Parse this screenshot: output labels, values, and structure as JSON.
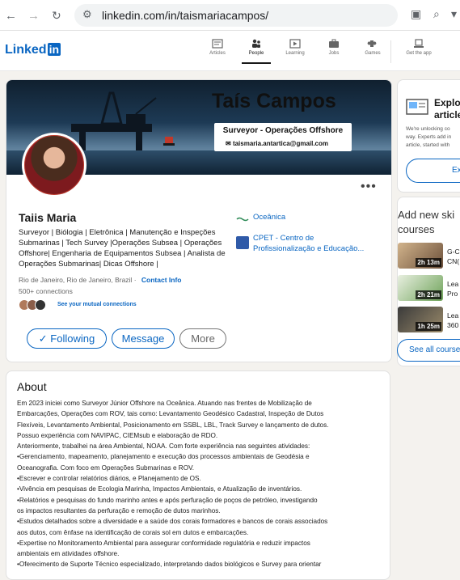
{
  "browser": {
    "url": "linkedin.com/in/taismariacampos/"
  },
  "header": {
    "logo_text": "Linked",
    "logo_in": "in",
    "nav": [
      {
        "label": "Articles",
        "icon": "articles-icon"
      },
      {
        "label": "People",
        "icon": "people-icon",
        "active": true
      },
      {
        "label": "Learning",
        "icon": "learning-icon"
      },
      {
        "label": "Jobs",
        "icon": "jobs-icon"
      },
      {
        "label": "Games",
        "icon": "games-icon"
      },
      {
        "label": "Get the app",
        "icon": "get-app-icon"
      }
    ]
  },
  "profile": {
    "banner_name": "Taís Campos",
    "banner_subtitle": "Surveyor - Operações Offshore",
    "banner_email": "taismaria.antartica@gmail.com",
    "name": "Taiis Maria",
    "headline": "Surveyor | Biólogia | Eletrônica | Manutenção e Inspeções Submarinas | Tech Survey |Operações Subsea | Operações Offshore| Engenharia de Equipamentos Subsea | Analista de Operações Submarinas| Dicas Offshore |",
    "location": "Rio de Janeiro, Rio de Janeiro, Brazil",
    "contact_info": "Contact Info",
    "connections": "500+ connections",
    "mutual": "See your mutual connections",
    "experience": [
      {
        "name": "Oceânica"
      },
      {
        "name": "CPET - Centro de Profissionalização e Educação..."
      }
    ],
    "buttons": {
      "following": "✓ Following",
      "message": "Message",
      "more": "More"
    }
  },
  "about": {
    "title": "About",
    "lines": [
      "Em 2023 iniciei como Surveyor Júnior Offshore na Oceânica. Atuando nas frentes de Mobilização de",
      "Embarcações, Operações com ROV, tais como: Levantamento Geodésico Cadastral, Inspeção de Dutos",
      "Flexíveis, Levantamento Ambiental, Posicionamento em SSBL, LBL, Track Survey e lançamento de dutos.",
      "Possuo experiência com NAVIPAC, CIEMsub e elaboração de RDO.",
      "Anteriormente, trabalhei na área Ambiental, NOAA. Com forte experiência nas seguintes atividades:",
      "•Gerenciamento, mapeamento, planejamento e execução dos processos ambientais de Geodésia e",
      "Oceanografia. Com foco em Operações Submarinas e ROV.",
      "•Escrever e controlar relatórios diários, e Planejamento de OS.",
      "•Vivência em pesquisas de Ecologia Marinha, Impactos Ambientais, e Atualização de inventários.",
      "•Relatórios e pesquisas do fundo marinho antes e após perfuração de poços de petróleo, investigando",
      "os impactos resultantes da perfuração e remoção de dutos marinhos.",
      "•Estudos detalhados sobre a diversidade e a saúde dos corais formadores e bancos de corais associados",
      "aos dutos, com ênfase na identificação de corais sol em dutos e embarcações.",
      "•Expertise no Monitoramento Ambiental para assegurar conformidade regulatória e reduzir impactos",
      "ambientais em atividades offshore.",
      "•Oferecimento de Suporte Técnico especializado, interpretando dados biológicos e Survey para orientar"
    ]
  },
  "sidebar": {
    "explore_title": "Explo",
    "explore_title2": "article",
    "explore_body1": "We're unlocking co",
    "explore_body2": "way. Experts add in",
    "explore_body3": "article, started with",
    "explore_button": "Ex",
    "skills_title1": "Add new ski",
    "skills_title2": "courses",
    "courses": [
      {
        "duration": "2h 13m",
        "line1": "G-C",
        "line2": "CN("
      },
      {
        "duration": "2h 21m",
        "line1": "Lea",
        "line2": "Pro"
      },
      {
        "duration": "1h 25m",
        "line1": "Lea",
        "line2": "360"
      }
    ],
    "see_all": "See all courses"
  }
}
